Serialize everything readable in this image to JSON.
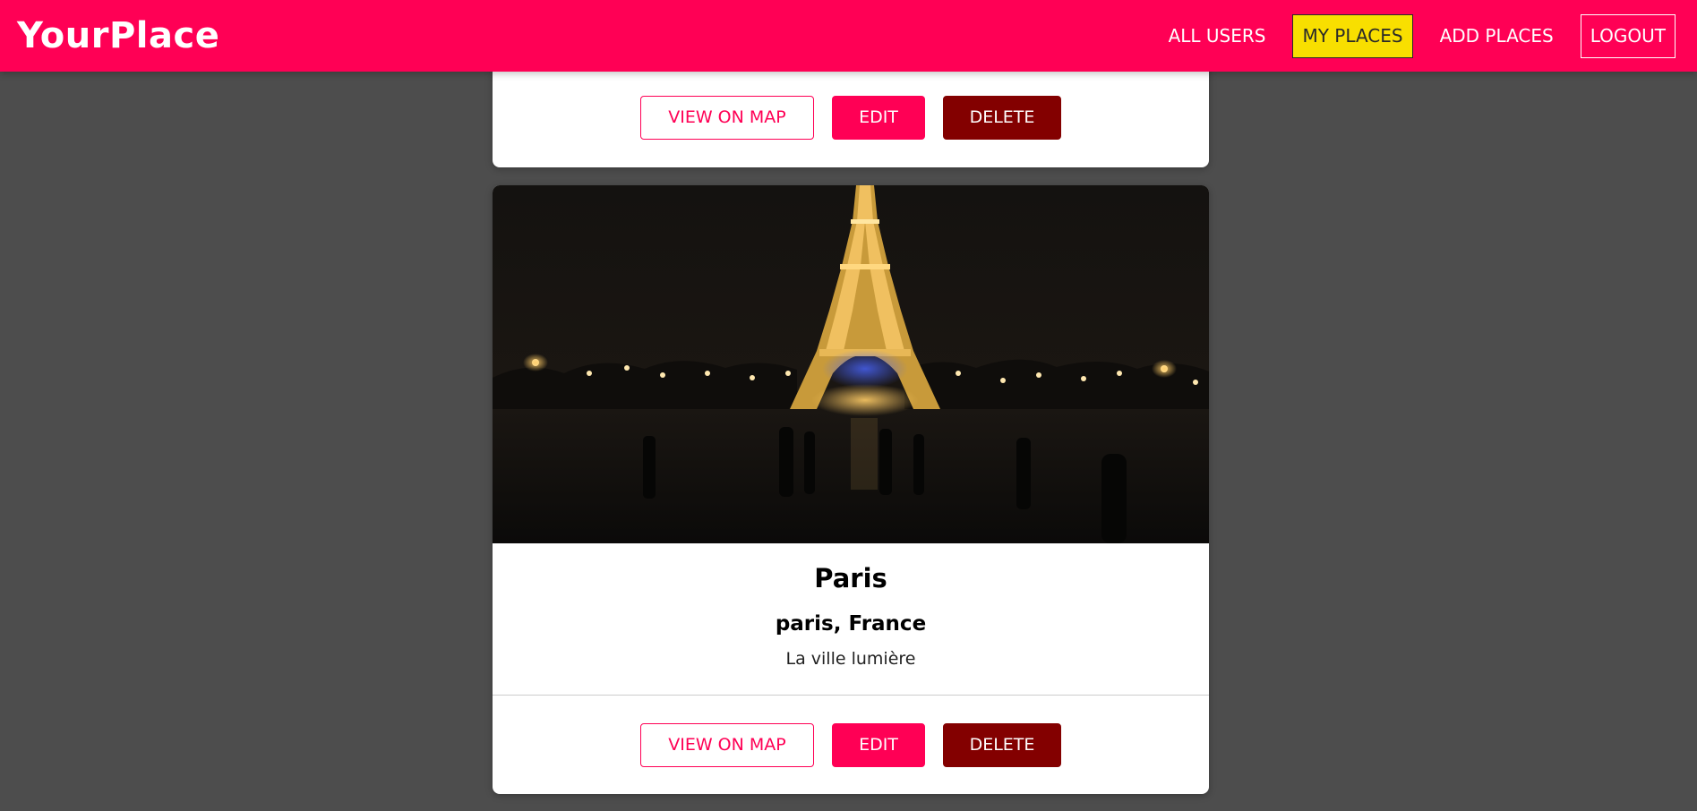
{
  "header": {
    "logo": "YourPlace",
    "nav": {
      "all_users": "ALL USERS",
      "my_places": "MY PLACES",
      "add_places": "ADD PLACES",
      "logout": "LOGOUT"
    },
    "active_nav": "MY PLACES"
  },
  "places": [
    {
      "actions": {
        "view_on_map": "VIEW ON MAP",
        "edit": "EDIT",
        "delete": "DELETE"
      }
    },
    {
      "image": "eiffel-tower-at-night",
      "title": "Paris",
      "address": "paris, France",
      "description": "La ville lumière",
      "actions": {
        "view_on_map": "VIEW ON MAP",
        "edit": "EDIT",
        "delete": "DELETE"
      }
    }
  ],
  "colors": {
    "brand": "#ff0055",
    "active_nav": "#f8df00",
    "danger": "#830000",
    "background": "#4d4d4d"
  }
}
